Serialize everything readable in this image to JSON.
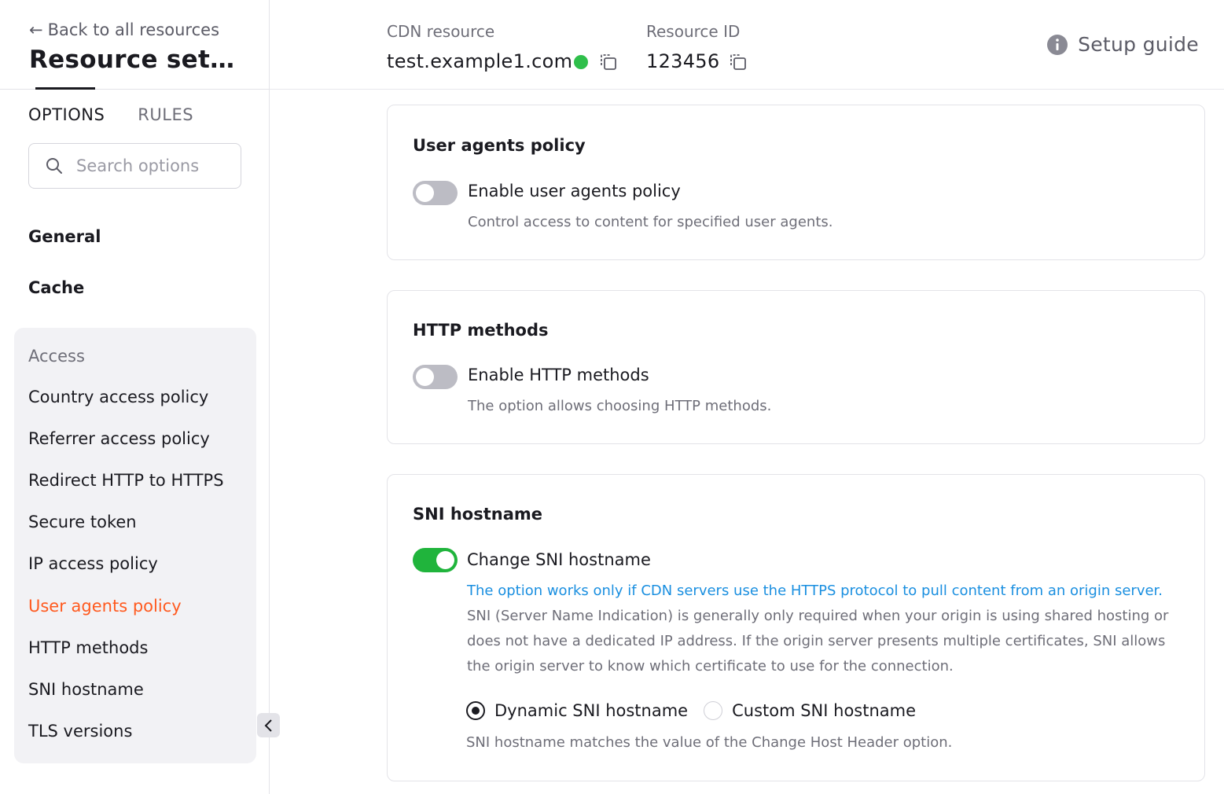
{
  "sidebar": {
    "back_link": "Back to all resources",
    "title": "Resource settin...",
    "tabs": [
      "OPTIONS",
      "RULES"
    ],
    "search_placeholder": "Search options",
    "top_items": [
      "General",
      "Cache"
    ],
    "group": {
      "title": "Access",
      "items": [
        "Country access policy",
        "Referrer access policy",
        "Redirect HTTP to HTTPS",
        "Secure token",
        "IP access policy",
        "User agents policy",
        "HTTP methods",
        "SNI hostname",
        "TLS versions"
      ],
      "active_item": "User agents policy"
    }
  },
  "header": {
    "cdn_label": "CDN resource",
    "cdn_value": "test.example1.com",
    "id_label": "Resource ID",
    "id_value": "123456",
    "setup_guide": "Setup guide"
  },
  "cards": {
    "user_agents": {
      "title": "User agents policy",
      "toggle_label": "Enable user agents policy",
      "toggle_on": false,
      "description": "Control access to content for specified user agents."
    },
    "http_methods": {
      "title": "HTTP methods",
      "toggle_label": "Enable HTTP methods",
      "toggle_on": false,
      "description": "The option allows choosing HTTP methods."
    },
    "sni": {
      "title": "SNI hostname",
      "toggle_label": "Change SNI hostname",
      "toggle_on": true,
      "info": "The option works only if CDN servers use the HTTPS protocol to pull content from an origin server.",
      "long_description": "SNI (Server Name Indication) is generally only required when your origin is using shared hosting or does not have a dedicated IP address. If the origin server presents multiple certificates, SNI allows the origin server to know which certificate to use for the connection.",
      "radio_dynamic": "Dynamic SNI hostname",
      "radio_custom": "Custom SNI hostname",
      "selected": "Dynamic SNI hostname",
      "radio_hint": "SNI hostname matches the value of the Change Host Header option."
    }
  },
  "colors": {
    "accent_active": "#ff5a1f",
    "toggle_on": "#20b43c",
    "status_online": "#2fbf4b",
    "link": "#1a8fe0"
  }
}
